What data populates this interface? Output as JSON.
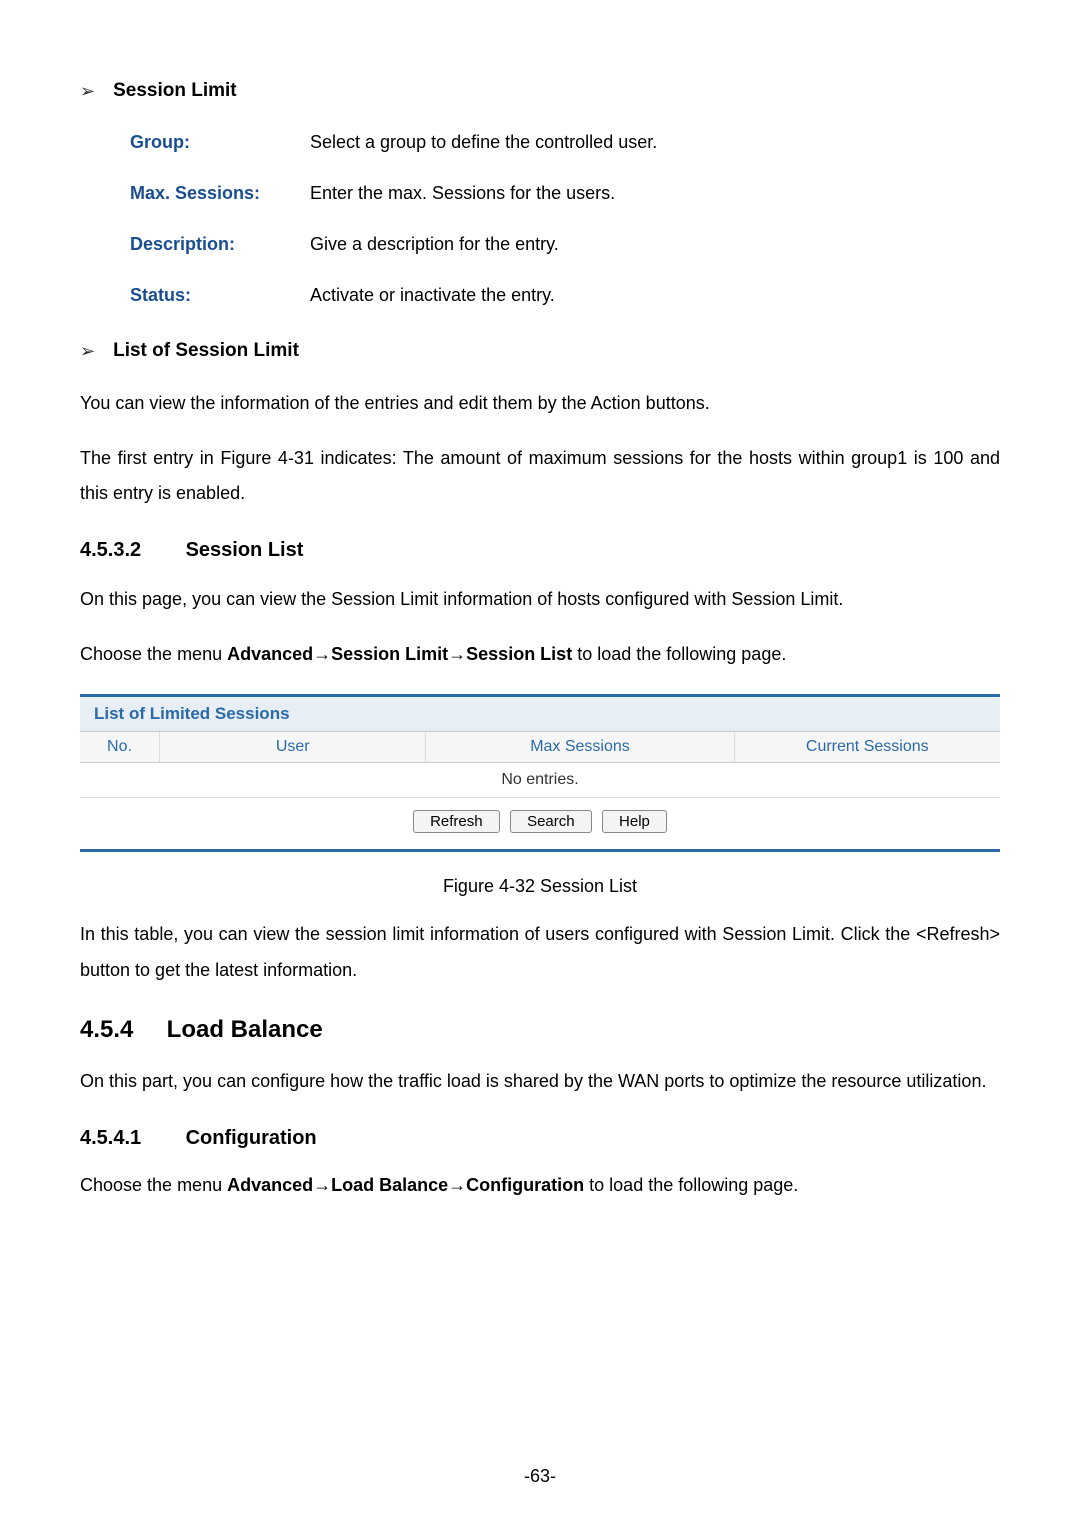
{
  "section1": {
    "title": "Session Limit",
    "defs": [
      {
        "label": "Group:",
        "value": "Select a group to define the controlled user."
      },
      {
        "label": "Max. Sessions:",
        "value": "Enter the max. Sessions for the users."
      },
      {
        "label": "Description:",
        "value": "Give a description for the entry."
      },
      {
        "label": "Status:",
        "value": "Activate or inactivate the entry."
      }
    ]
  },
  "section2": {
    "title": "List of Session Limit",
    "p1": "You can view the information of the entries and edit them by the Action buttons.",
    "p2": "The first entry in Figure 4-31 indicates: The amount of maximum sessions for the hosts within group1 is 100 and this entry is enabled."
  },
  "h4_1": {
    "num": "4.5.3.2",
    "title": "Session List"
  },
  "p_h4_1": "On this page, you can view the Session Limit information of hosts configured with Session Limit.",
  "menu1": {
    "prefix": "Choose the menu ",
    "b1": "Advanced",
    "arrow": "→",
    "b2": "Session Limit",
    "b3": "Session List",
    "suffix": " to load the following page."
  },
  "table": {
    "title": "List of Limited Sessions",
    "headers": {
      "no": "No.",
      "user": "User",
      "max": "Max Sessions",
      "cur": "Current Sessions"
    },
    "empty": "No entries.",
    "buttons": {
      "refresh": "Refresh",
      "search": "Search",
      "help": "Help"
    }
  },
  "caption": "Figure 4-32 Session List",
  "p_after_fig": "In this table, you can view the session limit information of users configured with Session Limit. Click the <Refresh> button to get the latest information.",
  "h3_1": {
    "num": "4.5.4",
    "title": "Load Balance"
  },
  "p_h3_1": "On this part, you can configure how the traffic load is shared by the WAN ports to optimize the resource utilization.",
  "h4_2": {
    "num": "4.5.4.1",
    "title": "Configuration"
  },
  "menu2": {
    "prefix": "Choose the menu ",
    "b1": "Advanced",
    "arrow": "→",
    "b2": "Load Balance",
    "b3": "Configuration",
    "suffix": " to load the following page."
  },
  "pageno": "-63-"
}
